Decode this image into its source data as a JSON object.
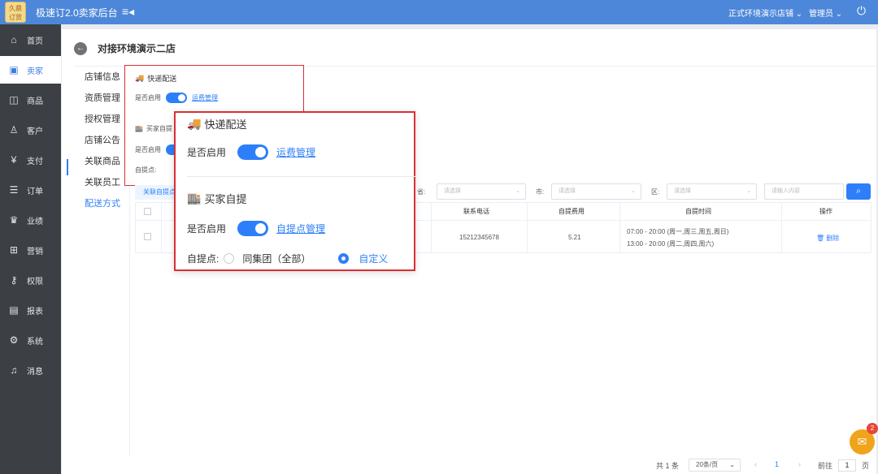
{
  "header": {
    "logo_text": "久鼎\n订货",
    "app_title": "极速订2.0卖家后台",
    "menu_toggle_icon": "≡◂",
    "store_name": "正式环境演示店铺",
    "store_chevron": "⌄",
    "user_role": "管理员",
    "user_chevron": "⌄",
    "power_icon": "⏻"
  },
  "sidebar": {
    "items": [
      {
        "label": "首页",
        "icon": "home-icon"
      },
      {
        "label": "卖家",
        "icon": "shop-icon"
      },
      {
        "label": "商品",
        "icon": "bag-icon"
      },
      {
        "label": "客户",
        "icon": "users-icon"
      },
      {
        "label": "支付",
        "icon": "payment-icon"
      },
      {
        "label": "订单",
        "icon": "order-icon"
      },
      {
        "label": "业绩",
        "icon": "trophy-icon"
      },
      {
        "label": "营销",
        "icon": "gift-icon"
      },
      {
        "label": "权限",
        "icon": "key-icon"
      },
      {
        "label": "报表",
        "icon": "report-icon"
      },
      {
        "label": "系统",
        "icon": "gear-icon"
      },
      {
        "label": "消息",
        "icon": "bell-icon"
      }
    ]
  },
  "page": {
    "title": "对接环境演示二店",
    "back_icon": "←"
  },
  "subnav": {
    "items": [
      "店铺信息",
      "资质管理",
      "授权管理",
      "店铺公告",
      "关联商品",
      "关联员工",
      "配送方式"
    ]
  },
  "delivery": {
    "express_title": "快递配送",
    "enable_label": "是否启用",
    "freight_link": "运费管理",
    "pickup_title": "买家自提",
    "pickup_link": "自提点管理",
    "pickup_point_label": "自提点:",
    "option_all": "同集团（全部）",
    "option_custom": "自定义",
    "mini_pickup_title": "买家自提",
    "mini_pickup_point_label": "自提点:"
  },
  "filters": {
    "tab_label": "关联自提点",
    "province_label": "省:",
    "city_label": "市:",
    "district_label": "区:",
    "select_placeholder": "请选择",
    "keyword_placeholder": "请输入内容",
    "search_icon": "⌕"
  },
  "table": {
    "columns": [
      "联系电话",
      "自提费用",
      "自提时间",
      "操作"
    ],
    "rows": [
      {
        "phone": "15212345678",
        "fee": "5.21",
        "time_line1": "07:00 - 20:00 (周一,周三,周五,周日)",
        "time_line2": "13:00 - 20:00 (周二,周四,周六)",
        "action": "删除",
        "action_icon": "🗑"
      }
    ]
  },
  "pagination": {
    "total": "共 1 条",
    "page_size": "20条/页",
    "prev": "‹",
    "current": "1",
    "next": "›",
    "goto_label": "前往",
    "goto_value": "1",
    "page_suffix": "页"
  },
  "chat": {
    "badge_count": "2",
    "icon": "✉"
  },
  "colors": {
    "primary": "#2d7ff9",
    "header": "#4d87d9",
    "sidebar": "#3c3f44",
    "highlight_border": "#d93036"
  }
}
